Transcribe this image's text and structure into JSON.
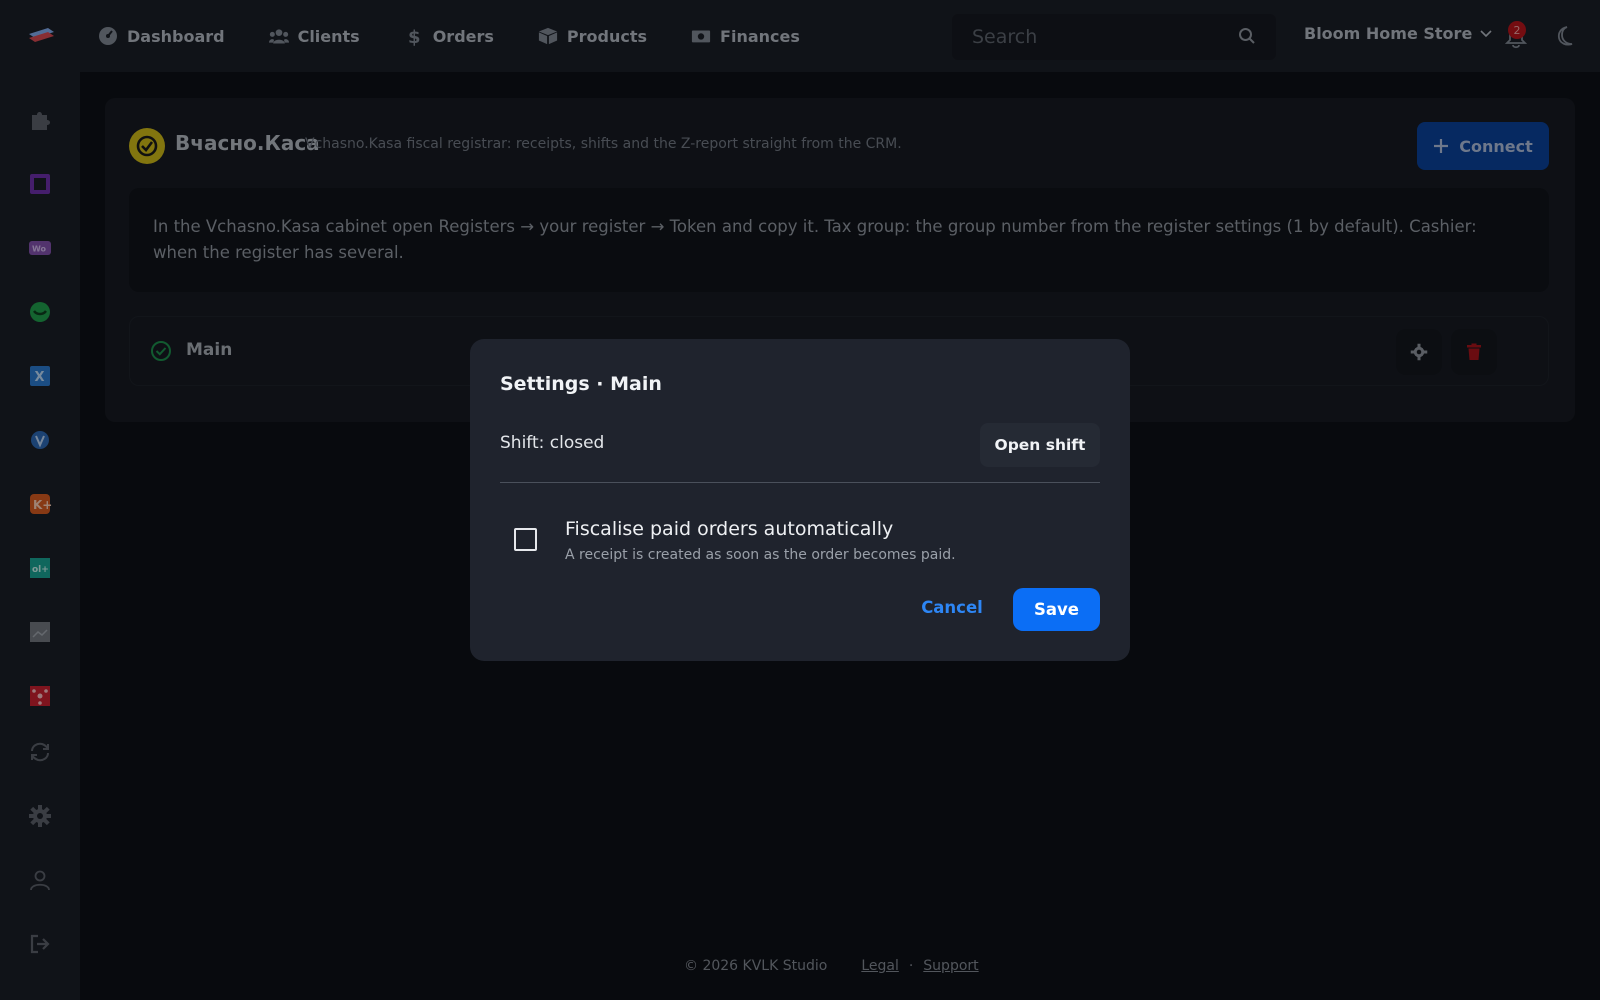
{
  "header": {
    "nav": [
      {
        "label": "Dashboard",
        "icon": "dashboard-icon"
      },
      {
        "label": "Clients",
        "icon": "users-icon"
      },
      {
        "label": "Orders",
        "icon": "dollar-icon"
      },
      {
        "label": "Products",
        "icon": "box-icon"
      },
      {
        "label": "Finances",
        "icon": "money-icon"
      }
    ],
    "search_placeholder": "Search",
    "store_name": "Bloom Home Store",
    "notification_count": "2"
  },
  "sidebar": {
    "items": [
      {
        "icon": "puzzle-icon",
        "color": "#5a5f68"
      },
      {
        "icon": "square-app-icon",
        "color": "#6b2fa6"
      },
      {
        "icon": "woo-icon",
        "color": "#7e4fa8"
      },
      {
        "icon": "green-app-icon",
        "color": "#1f9a4a"
      },
      {
        "icon": "x-app-icon",
        "color": "#2a77c9"
      },
      {
        "icon": "shield-app-icon",
        "color": "#2b66b0"
      },
      {
        "icon": "k-app-icon",
        "color": "#d0581f"
      },
      {
        "icon": "ol-app-icon",
        "color": "#1a9f8f"
      },
      {
        "icon": "image-app-icon",
        "color": "#6f747c"
      },
      {
        "icon": "network-app-icon",
        "color": "#c3202f"
      },
      {
        "icon": "sync-icon",
        "color": "#5a5f68"
      },
      {
        "icon": "gear-icon",
        "color": "#5a5f68"
      },
      {
        "icon": "user-icon",
        "color": "#5a5f68"
      },
      {
        "icon": "logout-icon",
        "color": "#5a5f68"
      }
    ]
  },
  "integration": {
    "name": "Вчасно.Каса",
    "description": "Vchasno.Kasa fiscal registrar: receipts, shifts and the Z-report straight from the CRM.",
    "connect_label": "Connect",
    "info_text": "In the Vchasno.Kasa cabinet open Registers → your register → Token and copy it. Tax group: the group number from the register settings (1 by default). Cashier: when the register has several.",
    "register_name": "Main"
  },
  "modal": {
    "title": "Settings · Main",
    "shift_status": "Shift: closed",
    "open_shift_label": "Open shift",
    "auto_fiscalise_label": "Fiscalise paid orders automatically",
    "auto_fiscalise_help": "A receipt is created as soon as the order becomes paid.",
    "auto_fiscalise_checked": false,
    "cancel_label": "Cancel",
    "save_label": "Save"
  },
  "footer": {
    "copyright": "© 2026 KVLK Studio",
    "legal": "Legal",
    "separator": "·",
    "support": "Support"
  }
}
